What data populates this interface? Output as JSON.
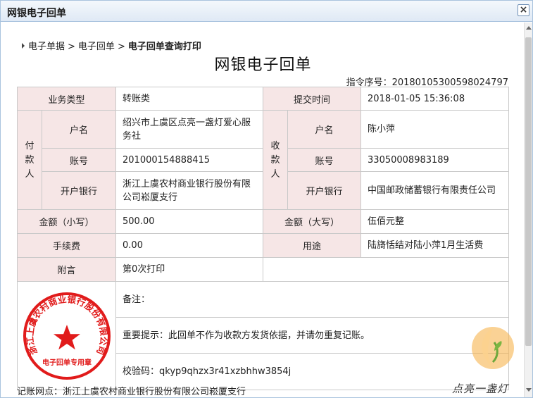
{
  "window": {
    "title": "网银电子回单",
    "close_symbol": "×"
  },
  "breadcrumb": {
    "items": [
      "电子单据",
      "电子回单"
    ],
    "separator": ">",
    "current": "电子回单查询打印"
  },
  "document": {
    "title": "网银电子回单",
    "serial_label": "指令序号：",
    "serial_value": "20180105300598024797"
  },
  "receipt": {
    "business_type_label": "业务类型",
    "business_type_value": "转账类",
    "submit_time_label": "提交时间",
    "submit_time_value": "2018-01-05 15:36:08",
    "payer_label": [
      "付",
      "款",
      "人"
    ],
    "payee_label": [
      "收",
      "款",
      "人"
    ],
    "payer": {
      "name_label": "户名",
      "name_value": "绍兴市上虞区点亮一盏灯爱心服务社",
      "account_label": "账号",
      "account_value": "201000154888415",
      "bank_label": "开户银行",
      "bank_value": "浙江上虞农村商业银行股份有限公司崧厦支行"
    },
    "payee": {
      "name_label": "户名",
      "name_value": "陈小萍",
      "account_label": "账号",
      "account_value": "33050008983189",
      "bank_label": "开户银行",
      "bank_value": "中国邮政储蓄银行有限责任公司"
    },
    "amount_lower_label": "金额（小写）",
    "amount_lower_value": "500.00",
    "amount_upper_label": "金额（大写）",
    "amount_upper_value": "伍佰元整",
    "fee_label": "手续费",
    "fee_value": "0.00",
    "purpose_label": "用途",
    "purpose_value": "陆旖恬结对陆小萍1月生活费",
    "postscript_label": "附言",
    "postscript_value": "第0次打印",
    "remark": "备注：",
    "notice": "重要提示：此回单不作为收款方发货依据，并请勿重复记账。",
    "checksum": "校验码：qkyp9qhzx3r41xzbhhw3854j"
  },
  "stamp": {
    "text": "浙江上虞农村商业银行股份有限公司",
    "bottom_text": "电子回单专用章",
    "color": "#e11b1b"
  },
  "footer": {
    "text": "记账网点：浙江上虞农村商业银行股份有限公司崧厦支行"
  },
  "watermark": {
    "text": "点亮一盏灯",
    "color": "#f3a23c"
  }
}
